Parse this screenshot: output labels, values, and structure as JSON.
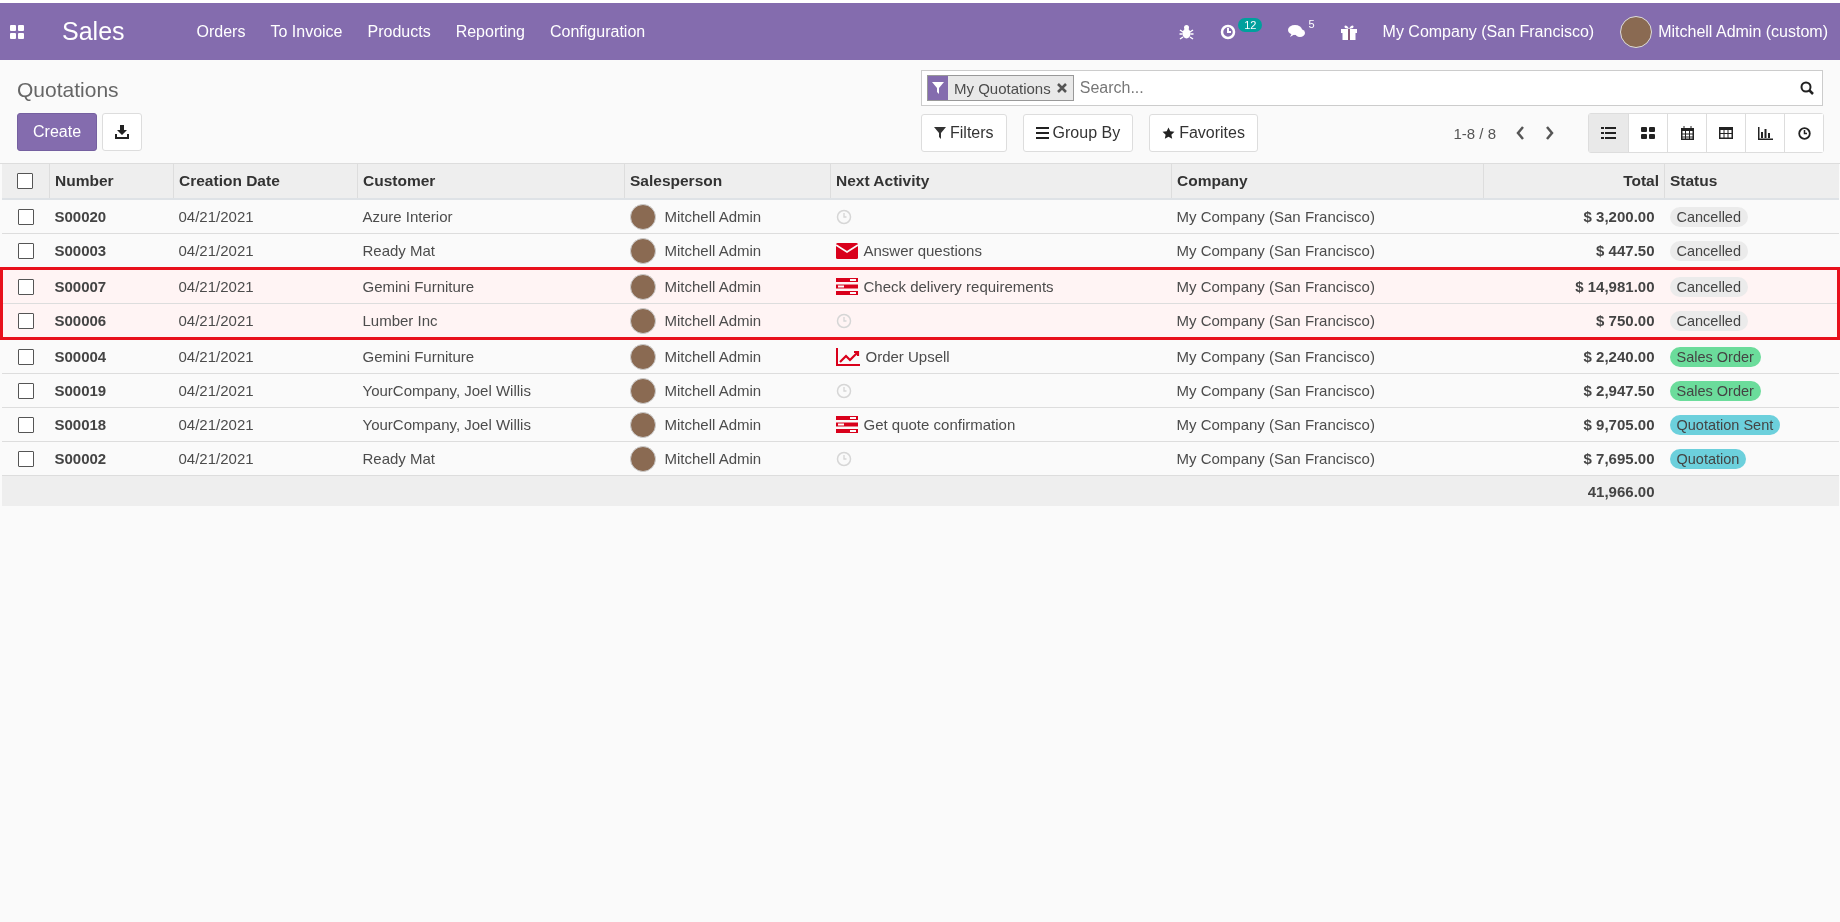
{
  "navbar": {
    "app_title": "Sales",
    "menu": [
      "Orders",
      "To Invoice",
      "Products",
      "Reporting",
      "Configuration"
    ],
    "activity_count": "12",
    "message_count": "5",
    "company": "My Company (San Francisco)",
    "user": "Mitchell Admin (custom)"
  },
  "control_panel": {
    "title": "Quotations",
    "create_label": "Create",
    "facet": "My Quotations",
    "search_placeholder": "Search...",
    "filters_label": "Filters",
    "group_by_label": "Group By",
    "favorites_label": "Favorites",
    "pager": "1-8 / 8",
    "views": [
      {
        "kind": "list",
        "selected": true
      },
      {
        "kind": "kanban",
        "selected": false
      },
      {
        "kind": "calendar",
        "selected": false
      },
      {
        "kind": "pivot",
        "selected": false
      },
      {
        "kind": "graph",
        "selected": false
      },
      {
        "kind": "activity",
        "selected": false
      }
    ]
  },
  "table": {
    "select_all_checked": false,
    "columns": [
      "Number",
      "Creation Date",
      "Customer",
      "Salesperson",
      "Next Activity",
      "Company",
      "Total",
      "Status"
    ],
    "rows": [
      {
        "number": "S00020",
        "date": "04/21/2021",
        "customer": "Azure Interior",
        "salesperson": "Mitchell Admin",
        "activity": {
          "kind": "none"
        },
        "company": "My Company (San Francisco)",
        "total": "$ 3,200.00",
        "status": "Cancelled",
        "color": "#ebebeb",
        "checked": false,
        "highlighted": false
      },
      {
        "number": "S00003",
        "date": "04/21/2021",
        "customer": "Ready Mat",
        "salesperson": "Mitchell Admin",
        "activity": {
          "kind": "email",
          "label": "Answer questions"
        },
        "company": "My Company (San Francisco)",
        "total": "$ 447.50",
        "status": "Cancelled",
        "color": "#ebebeb",
        "checked": false,
        "highlighted": false
      },
      {
        "number": "S00007",
        "date": "04/21/2021",
        "customer": "Gemini Furniture",
        "salesperson": "Mitchell Admin",
        "activity": {
          "kind": "task",
          "label": "Check delivery requirements"
        },
        "company": "My Company (San Francisco)",
        "total": "$ 14,981.00",
        "status": "Cancelled",
        "color": "#ebebeb",
        "checked": false,
        "highlighted": true
      },
      {
        "number": "S00006",
        "date": "04/21/2021",
        "customer": "Lumber Inc",
        "salesperson": "Mitchell Admin",
        "activity": {
          "kind": "none"
        },
        "company": "My Company (San Francisco)",
        "total": "$ 750.00",
        "status": "Cancelled",
        "color": "#ebebeb",
        "checked": false,
        "highlighted": true
      },
      {
        "number": "S00004",
        "date": "04/21/2021",
        "customer": "Gemini Furniture",
        "salesperson": "Mitchell Admin",
        "activity": {
          "kind": "upsell",
          "label": "Order Upsell"
        },
        "company": "My Company (San Francisco)",
        "total": "$ 2,240.00",
        "status": "Sales Order",
        "color": "#6bdc9b",
        "checked": false,
        "highlighted": false
      },
      {
        "number": "S00019",
        "date": "04/21/2021",
        "customer": "YourCompany, Joel Willis",
        "salesperson": "Mitchell Admin",
        "activity": {
          "kind": "none"
        },
        "company": "My Company (San Francisco)",
        "total": "$ 2,947.50",
        "status": "Sales Order",
        "color": "#6bdc9b",
        "checked": false,
        "highlighted": false
      },
      {
        "number": "S00018",
        "date": "04/21/2021",
        "customer": "YourCompany, Joel Willis",
        "salesperson": "Mitchell Admin",
        "activity": {
          "kind": "task",
          "label": "Get quote confirmation"
        },
        "company": "My Company (San Francisco)",
        "total": "$ 9,705.00",
        "status": "Quotation Sent",
        "color": "#6cd0dc",
        "checked": false,
        "highlighted": false
      },
      {
        "number": "S00002",
        "date": "04/21/2021",
        "customer": "Ready Mat",
        "salesperson": "Mitchell Admin",
        "activity": {
          "kind": "none"
        },
        "company": "My Company (San Francisco)",
        "total": "$ 7,695.00",
        "status": "Quotation",
        "color": "#6cd0dc",
        "checked": false,
        "highlighted": false
      }
    ],
    "sum_total": "41,966.00"
  }
}
